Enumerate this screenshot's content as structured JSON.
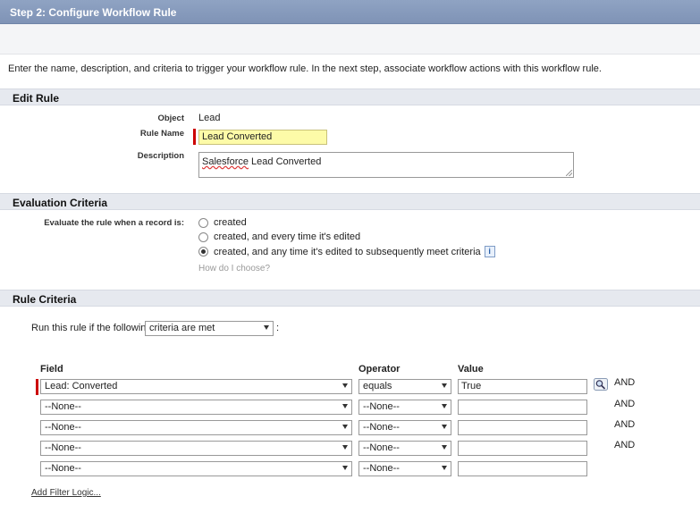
{
  "header": {
    "title": "Step 2: Configure Workflow Rule"
  },
  "intro_text": "Enter the name, description, and criteria to trigger your workflow rule. In the next step, associate workflow actions with this workflow rule.",
  "edit_rule": {
    "section_title": "Edit Rule",
    "object_label": "Object",
    "object_value": "Lead",
    "rule_name_label": "Rule Name",
    "rule_name_value": "Lead Converted",
    "description_label": "Description",
    "description_word1": "Salesforce",
    "description_rest": " Lead Converted"
  },
  "evaluation": {
    "section_title": "Evaluation Criteria",
    "prompt": "Evaluate the rule when a record is:",
    "options": [
      {
        "label": "created",
        "checked": false
      },
      {
        "label": "created, and every time it's edited",
        "checked": false
      },
      {
        "label": "created, and any time it's edited to subsequently meet criteria",
        "checked": true
      }
    ],
    "info_icon": "i",
    "help_link": "How do I choose?"
  },
  "rule_criteria": {
    "section_title": "Rule Criteria",
    "run_prefix": "Run this rule if the following",
    "run_select": "criteria are met",
    "run_suffix": ":",
    "headers": {
      "field": "Field",
      "operator": "Operator",
      "value": "Value"
    },
    "rows": [
      {
        "field": "Lead: Converted",
        "operator": "equals",
        "value": "True",
        "and": "AND"
      },
      {
        "field": "--None--",
        "operator": "--None--",
        "value": "",
        "and": "AND"
      },
      {
        "field": "--None--",
        "operator": "--None--",
        "value": "",
        "and": "AND"
      },
      {
        "field": "--None--",
        "operator": "--None--",
        "value": "",
        "and": "AND"
      },
      {
        "field": "--None--",
        "operator": "--None--",
        "value": "",
        "and": ""
      }
    ],
    "add_filter_logic": "Add Filter Logic..."
  }
}
